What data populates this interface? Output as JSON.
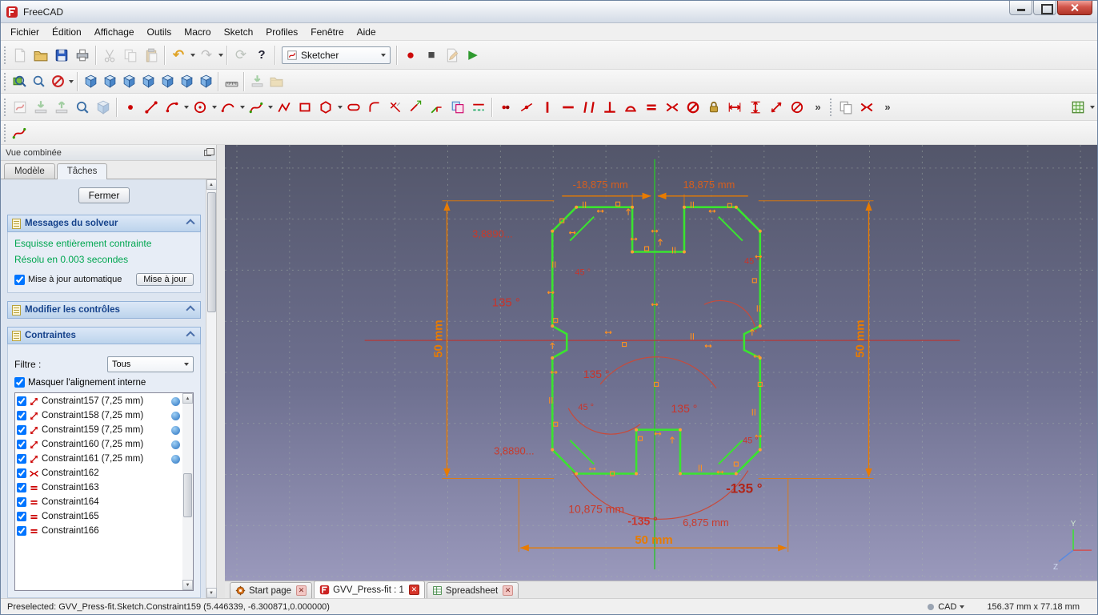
{
  "window": {
    "title": "FreeCAD"
  },
  "menu": {
    "items": [
      "Fichier",
      "Édition",
      "Affichage",
      "Outils",
      "Macro",
      "Sketch",
      "Profiles",
      "Fenêtre",
      "Aide"
    ]
  },
  "toolbar": {
    "workbench": "Sketcher",
    "glyphs": {
      "undo": "↶",
      "redo": "↷",
      "refresh": "⟳",
      "whatsthis": "?",
      "record": "●",
      "stop": "■",
      "play": "▶",
      "more": "»"
    }
  },
  "ui": {
    "arrow_up": "▲",
    "arrow_down": "▼",
    "arrow_left": "◀",
    "arrow_right": "▶",
    "close_x": "✕"
  },
  "panel": {
    "title": "Vue combinée",
    "tabs": {
      "model": "Modèle",
      "tasks": "Tâches"
    },
    "close_button": "Fermer",
    "solver": {
      "header": "Messages du solveur",
      "status_line1": "Esquisse entièrement contrainte",
      "status_line2": "Résolu en 0.003 secondes",
      "auto_update": "Mise à jour automatique",
      "update_button": "Mise à jour"
    },
    "controls_header": "Modifier les contrôles",
    "constraints": {
      "header": "Contraintes",
      "filter_label": "Filtre :",
      "filter_value": "Tous",
      "hide_internal": "Masquer l'alignement interne",
      "items": [
        {
          "label": "Constraint157 (7,25 mm)"
        },
        {
          "label": "Constraint158 (7,25 mm)"
        },
        {
          "label": "Constraint159 (7,25 mm)"
        },
        {
          "label": "Constraint160 (7,25 mm)"
        },
        {
          "label": "Constraint161 (7,25 mm)"
        },
        {
          "label": "Constraint162"
        },
        {
          "label": "Constraint163"
        },
        {
          "label": "Constraint164"
        },
        {
          "label": "Constraint165"
        },
        {
          "label": "Constraint166"
        }
      ]
    }
  },
  "viewport": {
    "labels": [
      "-18,875 mm",
      "18,875 mm",
      "3,8890...",
      "135 °",
      "50 mm",
      "50 mm",
      "45 °",
      "45 °",
      "135 °",
      "135 °",
      "45 °",
      "3,8890...",
      "-135 °",
      "-135 °",
      "10,875 mm",
      "6,875 mm",
      "50 mm",
      "45 °"
    ],
    "axis": {
      "y": "Y",
      "z": "Z"
    }
  },
  "doc_tabs": [
    {
      "label": "Start page"
    },
    {
      "label": "GVV_Press-fit : 1"
    },
    {
      "label": "Spreadsheet"
    }
  ],
  "statusbar": {
    "message": "Preselected: GVV_Press-fit.Sketch.Constraint159 (5.446339, -6.300871,0.000000)",
    "nav_style": "CAD",
    "size_readout": "156.37 mm x 77.18 mm"
  },
  "colors": {
    "sketch_green": "#3ae42f",
    "constraint_orange": "#ff9020",
    "dimension_red": "#c9342a",
    "solver_green": "#00a650"
  }
}
